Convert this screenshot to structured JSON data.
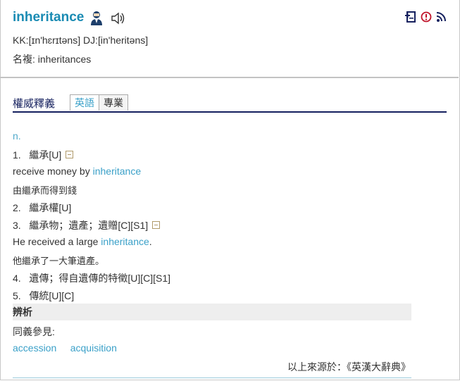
{
  "header": {
    "word": "inheritance",
    "pronunciation": "KK:[ɪn'hɛrɪtəns] DJ:[in'heritəns]",
    "plural": "名複: inheritances",
    "icons": [
      "person-icon",
      "speaker-icon",
      "notebook-add-icon",
      "report-icon",
      "rss-icon"
    ]
  },
  "tabs": {
    "main": "權威釋義",
    "items": [
      "英語",
      "專業"
    ],
    "active": "英語"
  },
  "entry": {
    "pos": "n.",
    "senses": [
      {
        "num": "1.",
        "def": "繼承[U]",
        "expand": true,
        "examples": [
          {
            "pre": "receive money by ",
            "kw": "inheritance",
            "post": "",
            "zh": "由繼承而得到錢"
          }
        ]
      },
      {
        "num": "2.",
        "def": "繼承權[U]",
        "expand": false,
        "examples": []
      },
      {
        "num": "3.",
        "def": "繼承物；遺產；遺贈[C][S1]",
        "expand": true,
        "examples": [
          {
            "pre": "He received a large ",
            "kw": "inheritance",
            "post": ".",
            "zh": "他繼承了一大筆遺產。"
          }
        ]
      },
      {
        "num": "4.",
        "def": "遺傳；得自遺傳的特徵[U][C][S1]",
        "expand": false,
        "examples": []
      },
      {
        "num": "5.",
        "def": "傳統[U][C]",
        "expand": false,
        "examples": []
      }
    ]
  },
  "bianxi": {
    "title": "辨析",
    "label": "同義參見:",
    "links": [
      "accession",
      "acquisition"
    ]
  },
  "source": "以上來源於：《英漢大辭典》",
  "colors": {
    "word": "#1a8bb3",
    "link": "#3aa0c8",
    "tab_border": "#15205e"
  }
}
